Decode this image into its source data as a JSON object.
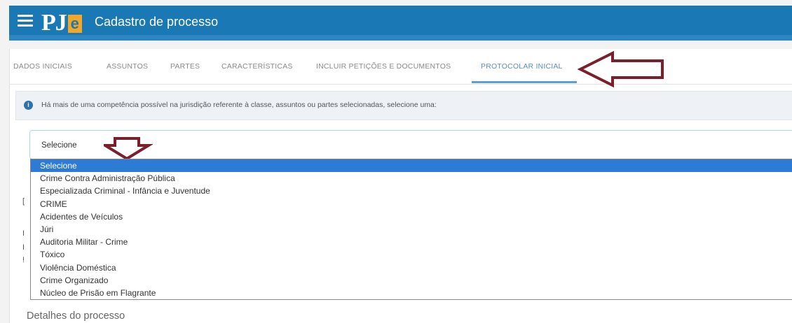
{
  "header": {
    "logo_text": "PJ",
    "logo_badge": "e",
    "title": "Cadastro de processo",
    "menu_icon": "hamburger-menu-icon"
  },
  "tabs": [
    {
      "label": "DADOS INICIAIS",
      "active": false
    },
    {
      "label": "ASSUNTOS",
      "active": false
    },
    {
      "label": "PARTES",
      "active": false
    },
    {
      "label": "CARACTERÍSTICAS",
      "active": false
    },
    {
      "label": "INCLUIR PETIÇÕES E DOCUMENTOS",
      "active": false
    },
    {
      "label": "PROTOCOLAR INICIAL",
      "active": true
    }
  ],
  "alert": {
    "icon": "info-icon",
    "text": "Há mais de uma competência possível na jurisdição referente à classe, assuntos ou partes selecionadas, selecione uma:"
  },
  "competencia_select": {
    "value": "Selecione",
    "options": [
      "Selecione",
      "Crime Contra Administração Pública",
      "Especializada Criminal - Infância e Juventude",
      "CRIME",
      "Acidentes de Veículos",
      "Júri",
      "Auditoria Militar - Crime",
      "Tóxico",
      "Violência Doméstica",
      "Crime Organizado",
      "Núcleo de Prisão em Flagrante"
    ],
    "selected_index": 0
  },
  "details": {
    "title": "Detalhes do processo"
  },
  "colors": {
    "header_bg": "#1a78b5",
    "active_tab": "#5a8fbf",
    "selected_option": "#2e7bd6",
    "annotation_arrow": "#7a1f2b"
  }
}
